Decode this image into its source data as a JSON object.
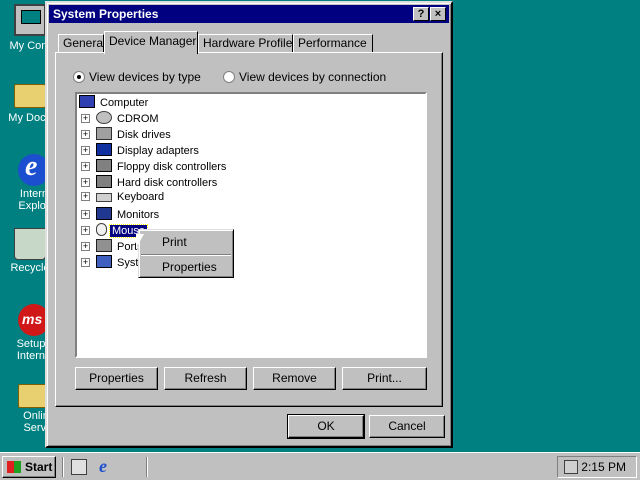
{
  "desktop": {
    "icons": [
      {
        "label": "My Com"
      },
      {
        "label": "My Docu"
      },
      {
        "label": "Intern Explor"
      },
      {
        "label": "Recycle"
      },
      {
        "label": "Setup I Interne"
      },
      {
        "label": "Onlin Servi"
      }
    ]
  },
  "window": {
    "title": "System Properties",
    "help_glyph": "?",
    "close_glyph": "×",
    "tabs": [
      "General",
      "Device Manager",
      "Hardware Profiles",
      "Performance"
    ],
    "active_tab": "Device Manager",
    "view_options": {
      "by_type": "View devices by type",
      "by_connection": "View devices by connection",
      "selected": "View devices by type"
    },
    "tree": {
      "root": "Computer",
      "items": [
        "CDROM",
        "Disk drives",
        "Display adapters",
        "Floppy disk controllers",
        "Hard disk controllers",
        "Keyboard",
        "Monitors",
        "Mouse",
        "Ports",
        "System"
      ],
      "selected": "Mouse",
      "expand_glyph": "+"
    },
    "context_menu": {
      "items": [
        "Print",
        "Properties"
      ]
    },
    "buttons": {
      "properties": "Properties",
      "refresh": "Refresh",
      "remove": "Remove",
      "print": "Print...",
      "ok": "OK",
      "cancel": "Cancel"
    }
  },
  "taskbar": {
    "start_label": "Start",
    "clock": "2:15 PM"
  }
}
